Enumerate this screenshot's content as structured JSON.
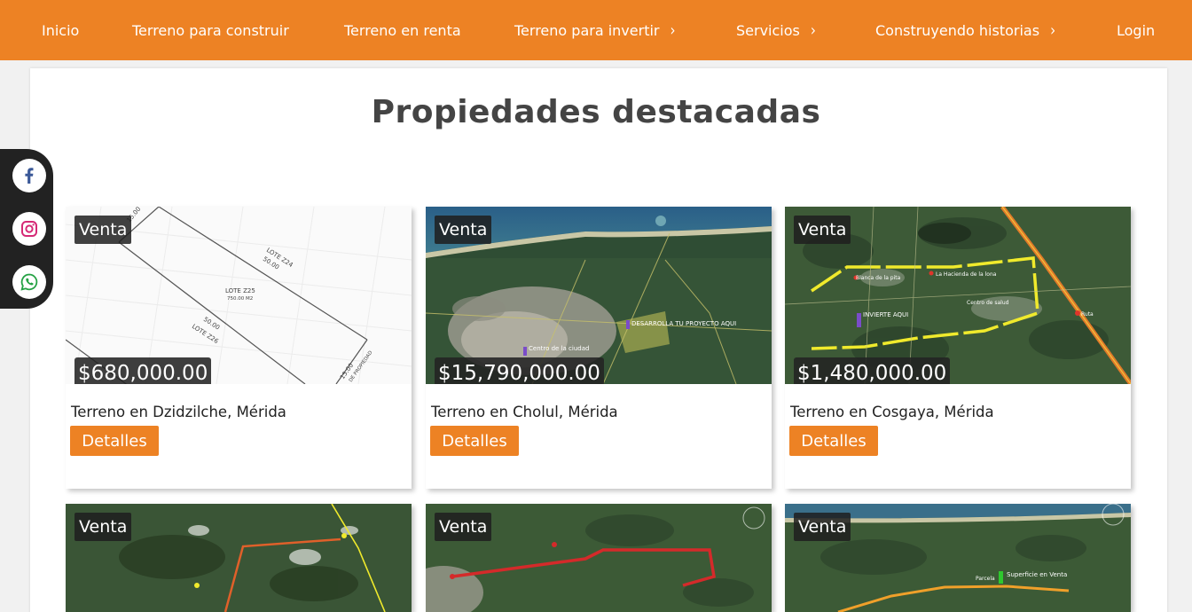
{
  "nav": {
    "items": [
      {
        "label": "Inicio"
      },
      {
        "label": "Terreno para construir"
      },
      {
        "label": "Terreno en renta"
      },
      {
        "label": "Terreno para invertir"
      },
      {
        "label": "Servicios"
      },
      {
        "label": "Construyendo historias"
      },
      {
        "label": "Login"
      }
    ],
    "chevron": "›"
  },
  "section": {
    "title": "Propiedades destacadas"
  },
  "social": {
    "facebook": "f",
    "whatsapp": "✆"
  },
  "properties": [
    {
      "badge": "Venta",
      "price": "$680,000.00",
      "title": "Terreno en Dzidzilche, Mérida",
      "button": "Detalles",
      "plan": {
        "lot": "LOTE Z25",
        "area": "750.00 M2",
        "lot_top": "LOTE Z24",
        "lot_bottom": "LOTE Z26",
        "dim_top": "50.00",
        "dim_bottom": "50.00",
        "dim_right": "15.00",
        "dim_right_label": "DE PROPIEDAD",
        "dim_left": "15.00"
      }
    },
    {
      "badge": "Venta",
      "price": "$15,790,000.00",
      "title": "Terreno en Cholul, Mérida",
      "button": "Detalles",
      "map": {
        "label1": "DESARROLLA TU PROYECTO AQUI",
        "label2": "Centro de la ciudad"
      }
    },
    {
      "badge": "Venta",
      "price": "$1,480,000.00",
      "title": "Terreno en Cosgaya, Mérida",
      "button": "Detalles",
      "map": {
        "label1": "INVIERTE AQUI",
        "label2": "Blanca de la pita",
        "label3": "La Hacienda de la lona",
        "label4": "Centro de salud",
        "label5": "Ruta"
      }
    },
    {
      "badge": "Venta"
    },
    {
      "badge": "Venta"
    },
    {
      "badge": "Venta",
      "map": {
        "label1": "Superficie en Venta",
        "label2": "Parcela"
      }
    }
  ],
  "colors": {
    "accent": "#ed8224",
    "header_text": "#ffffff",
    "badge_bg": "#1e1e1e"
  }
}
